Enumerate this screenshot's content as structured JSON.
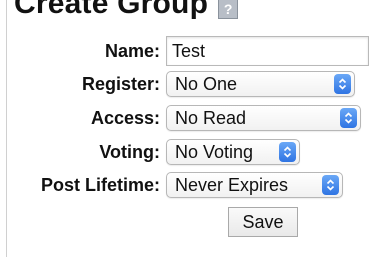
{
  "page": {
    "title": "Create Group",
    "help_icon_label": "?"
  },
  "form": {
    "name": {
      "label": "Name:",
      "value": "Test"
    },
    "register": {
      "label": "Register:",
      "value": "No One"
    },
    "access": {
      "label": "Access:",
      "value": "No Read"
    },
    "voting": {
      "label": "Voting:",
      "value": "No Voting"
    },
    "post_lifetime": {
      "label": "Post Lifetime:",
      "value": "Never Expires"
    },
    "save_label": "Save"
  },
  "icons": {
    "help": "help-icon",
    "select_stepper": "chevron-updown-icon"
  },
  "colors": {
    "stepper_accent": "#3d82ec"
  }
}
